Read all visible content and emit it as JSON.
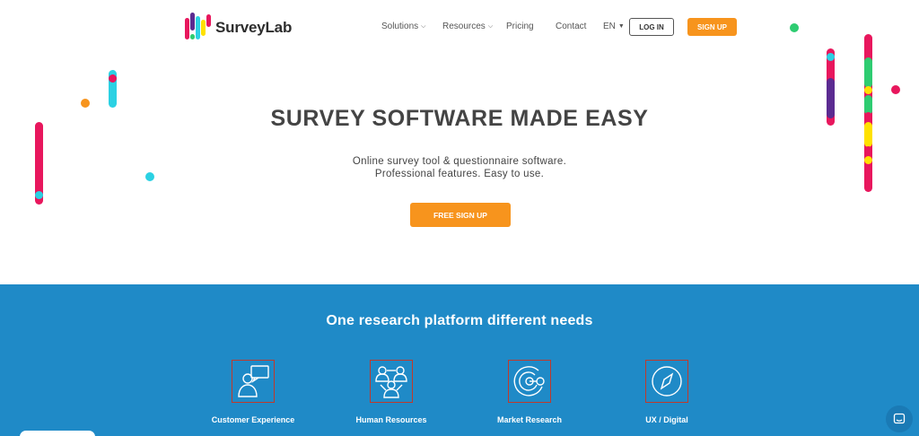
{
  "brand": {
    "name": "SurveyLab"
  },
  "nav": {
    "solutions": "Solutions",
    "resources": "Resources",
    "pricing": "Pricing",
    "contact": "Contact",
    "language": "EN",
    "login": "LOG IN",
    "signup": "SIGN UP"
  },
  "hero": {
    "title": "SURVEY SOFTWARE MADE EASY",
    "subtitle_line1": "Online survey tool & questionnaire software.",
    "subtitle_line2": "Professional features. Easy to use.",
    "cta": "FREE SIGN UP"
  },
  "section": {
    "title": "One research platform different needs",
    "features": [
      {
        "label": "Customer Experience",
        "icon": "customer-chat-icon"
      },
      {
        "label": "Human Resources",
        "icon": "team-people-icon"
      },
      {
        "label": "Market Research",
        "icon": "target-icon"
      },
      {
        "label": "UX / Digital",
        "icon": "compass-icon"
      }
    ]
  },
  "colors": {
    "accent_orange": "#f7941d",
    "section_blue": "#1f8ac7",
    "deco_pink": "#e8175d",
    "deco_cyan": "#2bd1e3",
    "deco_green": "#2ecc71",
    "deco_yellow": "#ffe100",
    "deco_purple": "#5b2b91"
  }
}
